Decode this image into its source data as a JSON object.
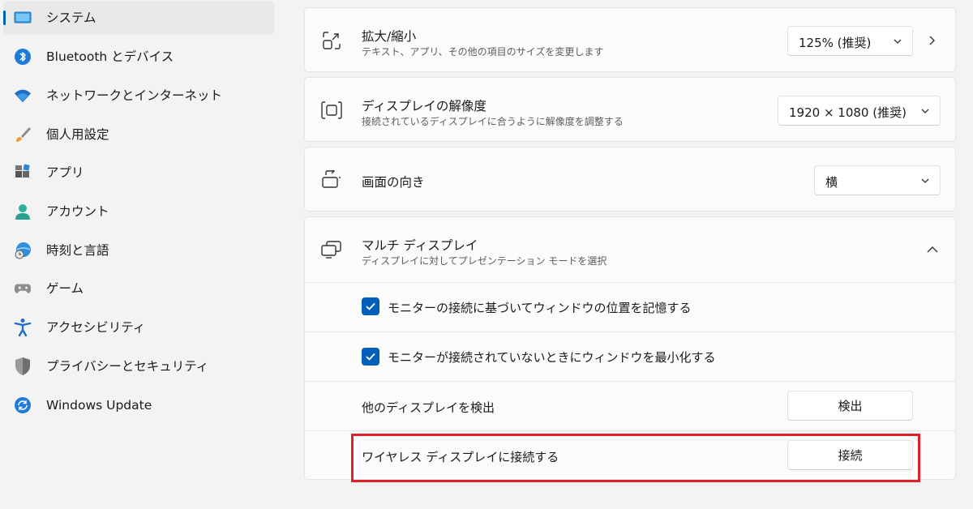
{
  "sidebar": {
    "items": [
      {
        "label": "システム",
        "icon": "monitor-icon",
        "selected": true
      },
      {
        "label": "Bluetooth とデバイス",
        "icon": "bluetooth-icon"
      },
      {
        "label": "ネットワークとインターネット",
        "icon": "wifi-icon"
      },
      {
        "label": "個人用設定",
        "icon": "brush-icon"
      },
      {
        "label": "アプリ",
        "icon": "apps-icon"
      },
      {
        "label": "アカウント",
        "icon": "account-icon"
      },
      {
        "label": "時刻と言語",
        "icon": "globe-clock-icon"
      },
      {
        "label": "ゲーム",
        "icon": "gamepad-icon"
      },
      {
        "label": "アクセシビリティ",
        "icon": "accessibility-icon"
      },
      {
        "label": "プライバシーとセキュリティ",
        "icon": "shield-icon"
      },
      {
        "label": "Windows Update",
        "icon": "update-icon"
      }
    ]
  },
  "scale": {
    "title": "拡大/縮小",
    "subtitle": "テキスト、アプリ、その他の項目のサイズを変更します",
    "value": "125% (推奨)"
  },
  "resolution": {
    "title": "ディスプレイの解像度",
    "subtitle": "接続されているディスプレイに合うように解像度を調整する",
    "value": "1920 × 1080 (推奨)"
  },
  "orientation": {
    "title": "画面の向き",
    "value": "横"
  },
  "multi": {
    "title": "マルチ ディスプレイ",
    "subtitle": "ディスプレイに対してプレゼンテーション モードを選択",
    "remember_label": "モニターの接続に基づいてウィンドウの位置を記憶する",
    "minimize_label": "モニターが接続されていないときにウィンドウを最小化する",
    "detect_label": "他のディスプレイを検出",
    "detect_button": "検出",
    "wireless_label": "ワイヤレス ディスプレイに接続する",
    "connect_button": "接続",
    "remember_checked": true,
    "minimize_checked": true
  },
  "colors": {
    "accent": "#005fb8",
    "highlight": "#e0202a"
  }
}
